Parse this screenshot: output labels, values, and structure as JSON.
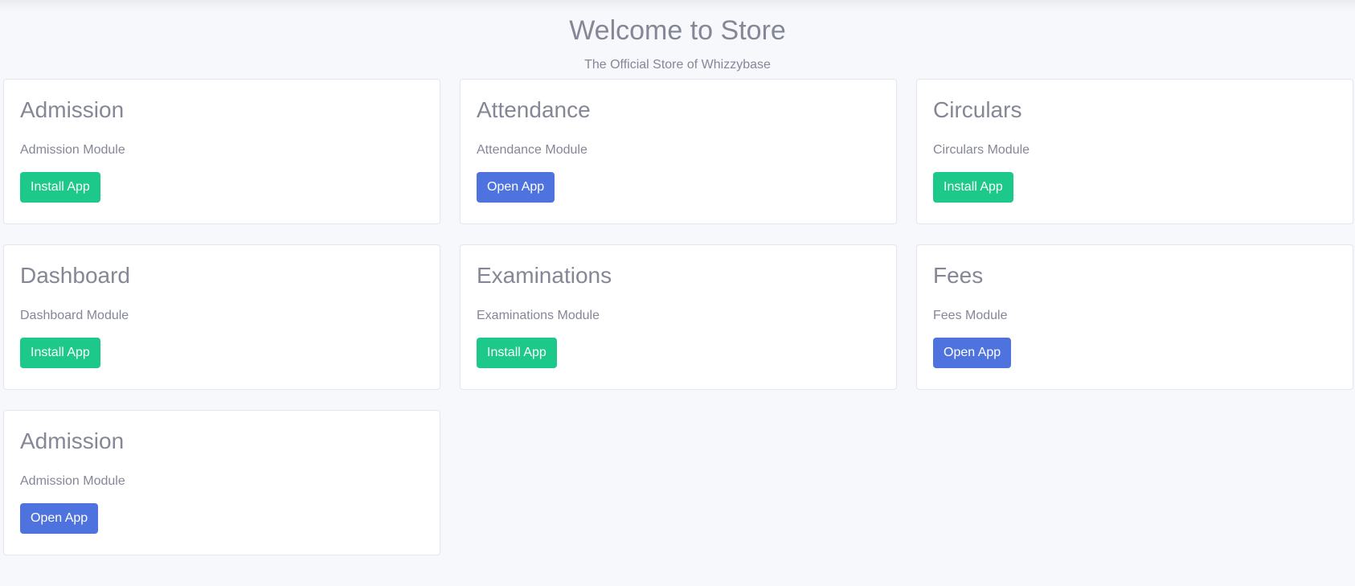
{
  "header": {
    "title": "Welcome to Store",
    "subtitle": "The Official Store of Whizzybase"
  },
  "colors": {
    "install": "#1cc88a",
    "open": "#4e73df",
    "text": "#858796",
    "background": "#f7f8fc"
  },
  "apps": [
    {
      "title": "Admission",
      "description": "Admission Module",
      "action": "Install App",
      "kind": "install"
    },
    {
      "title": "Attendance",
      "description": "Attendance Module",
      "action": "Open App",
      "kind": "open"
    },
    {
      "title": "Circulars",
      "description": "Circulars Module",
      "action": "Install App",
      "kind": "install"
    },
    {
      "title": "Dashboard",
      "description": "Dashboard Module",
      "action": "Install App",
      "kind": "install"
    },
    {
      "title": "Examinations",
      "description": "Examinations Module",
      "action": "Install App",
      "kind": "install"
    },
    {
      "title": "Fees",
      "description": "Fees Module",
      "action": "Open App",
      "kind": "open"
    },
    {
      "title": "Admission",
      "description": "Admission Module",
      "action": "Open App",
      "kind": "open"
    }
  ]
}
